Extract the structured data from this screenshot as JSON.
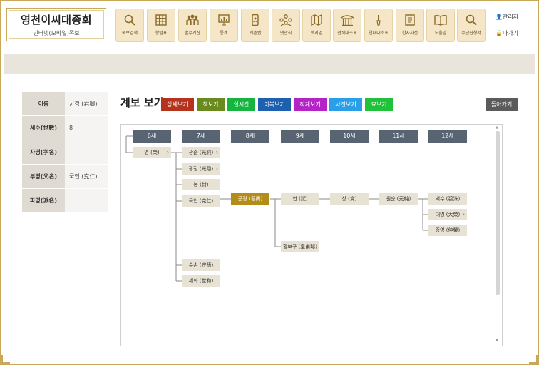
{
  "brand": {
    "title": "영천이씨대종회",
    "subtitle": "인터넷(모바일)족보"
  },
  "menu": [
    {
      "label": "족보검색",
      "icon": "magnifier-icon"
    },
    {
      "label": "항렬표",
      "icon": "grid-table-icon"
    },
    {
      "label": "촌수계산",
      "icon": "people-group-icon"
    },
    {
      "label": "통계",
      "icon": "presentation-chart-icon"
    },
    {
      "label": "계촌법",
      "icon": "phone-tree-icon"
    },
    {
      "label": "옛관직",
      "icon": "family-circle-icon"
    },
    {
      "label": "옛지명",
      "icon": "map-icon"
    },
    {
      "label": "관직대조표",
      "icon": "pavilion-icon"
    },
    {
      "label": "연대대조표",
      "icon": "brush-icon"
    },
    {
      "label": "한자사전",
      "icon": "dictionary-icon"
    },
    {
      "label": "도움말",
      "icon": "open-book-icon"
    },
    {
      "label": "수단신청서",
      "icon": "search-form-icon"
    }
  ],
  "util": {
    "admin": "관리자",
    "logout": "나가기"
  },
  "info": [
    {
      "key": "이름",
      "value": "군경 (君卿)"
    },
    {
      "key": "세수(世數)",
      "value": "8"
    },
    {
      "key": "자명(字名)",
      "value": ""
    },
    {
      "key": "부명(父名)",
      "value": "국인 (克仁)"
    },
    {
      "key": "파명(派名)",
      "value": ""
    }
  ],
  "page_title": "계보 보기",
  "view_buttons": [
    {
      "label": "상세보기",
      "color": "#b5321d"
    },
    {
      "label": "책보기",
      "color": "#6a8a1e"
    },
    {
      "label": "실시간",
      "color": "#16b540"
    },
    {
      "label": "이북보기",
      "color": "#1d60b0"
    },
    {
      "label": "직계보기",
      "color": "#b423c6"
    },
    {
      "label": "사진보기",
      "color": "#2a9ee6"
    },
    {
      "label": "묘보기",
      "color": "#21c23a"
    }
  ],
  "back_label": "돌아가기",
  "generations": [
    "6세",
    "7세",
    "8세",
    "9세",
    "10세",
    "11세",
    "12세"
  ],
  "tree": {
    "g6": [
      {
        "label": "영 (榮)",
        "expand": true
      }
    ],
    "g7": [
      {
        "label": "광순 (光純)",
        "expand": true
      },
      {
        "label": "광정 (光鼎)",
        "expand": true
      },
      {
        "label": "봉 (封)",
        "expand": false
      },
      {
        "label": "극인 (克仁)",
        "expand": false
      },
      {
        "label": "수손 (守孫)",
        "expand": false
      },
      {
        "label": "세화 (世和)",
        "expand": false
      }
    ],
    "g8": [
      {
        "label": "군경 (君卿)",
        "expand": false,
        "selected": true
      }
    ],
    "g9": [
      {
        "label": "연 (延)",
        "expand": false
      },
      {
        "label": "황보구 (皇甫球)",
        "expand": false
      }
    ],
    "g10": [
      {
        "label": "상 (賞)",
        "expand": false
      }
    ],
    "g11": [
      {
        "label": "원순 (元純)",
        "expand": false
      }
    ],
    "g12": [
      {
        "label": "벽수 (碧洙)",
        "expand": false
      },
      {
        "label": "대영 (大榮)",
        "expand": true
      },
      {
        "label": "증영 (仲榮)",
        "expand": false
      }
    ]
  }
}
